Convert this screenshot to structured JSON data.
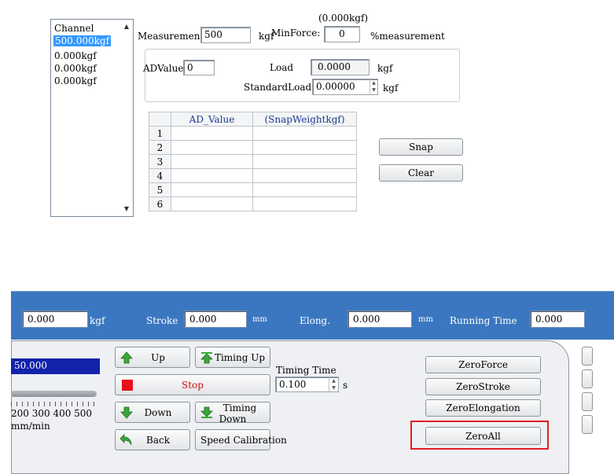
{
  "channel_list": {
    "header": "Channel",
    "items": [
      "500.000kgf",
      "0.000kgf",
      "0.000kgf",
      "0.000kgf"
    ],
    "selected_index": 0
  },
  "measurement": {
    "label": "Measurement",
    "value": "500",
    "unit": "kgf"
  },
  "min_force": {
    "caption": "(0.000kgf)",
    "label": "MinForce:",
    "value": "0",
    "unit": "%measurement"
  },
  "calib": {
    "ad_label": "ADValue",
    "ad_value": "0",
    "load_label": "Load",
    "load_value": "0.0000",
    "load_unit": "kgf",
    "standard_label": "StandardLoad",
    "standard_value": "0.00000",
    "standard_unit": "kgf"
  },
  "snap_table": {
    "columns": [
      "",
      "AD_Value",
      "(SnapWeightkgf)"
    ],
    "rows": [
      "1",
      "2",
      "3",
      "4",
      "5",
      "6"
    ]
  },
  "buttons": {
    "snap": "Snap",
    "clear": "Clear"
  },
  "toolbar": {
    "force_value": "0.000",
    "force_unit": "kgf",
    "stroke_label": "Stroke",
    "stroke_value": "0.000",
    "stroke_unit": "mm",
    "elong_label": "Elong.",
    "elong_value": "0.000",
    "elong_unit": "mm",
    "running_label": "Running Time",
    "running_value": "0.000"
  },
  "controls": {
    "speed_value": "50.000",
    "speed_ticks": "200  300  400  500",
    "speed_unit": "mm/min",
    "up": "Up",
    "timing_up": "Timing Up",
    "stop": "Stop",
    "down": "Down",
    "timing_down": "Timing Down",
    "back": "Back",
    "speed_calibration": "Speed Calibration",
    "timing_time_label": "Timing Time",
    "timing_time_value": "0.100",
    "timing_time_unit": "s",
    "zero_force": "ZeroForce",
    "zero_stroke": "ZeroStroke",
    "zero_elongation": "ZeroElongation",
    "zero_all": "ZeroAll"
  },
  "colors": {
    "toolbar_bg": "#3b77c0",
    "highlight": "#e0201f",
    "stop_red": "#e8101a",
    "arrow_green": "#3aa63a"
  }
}
